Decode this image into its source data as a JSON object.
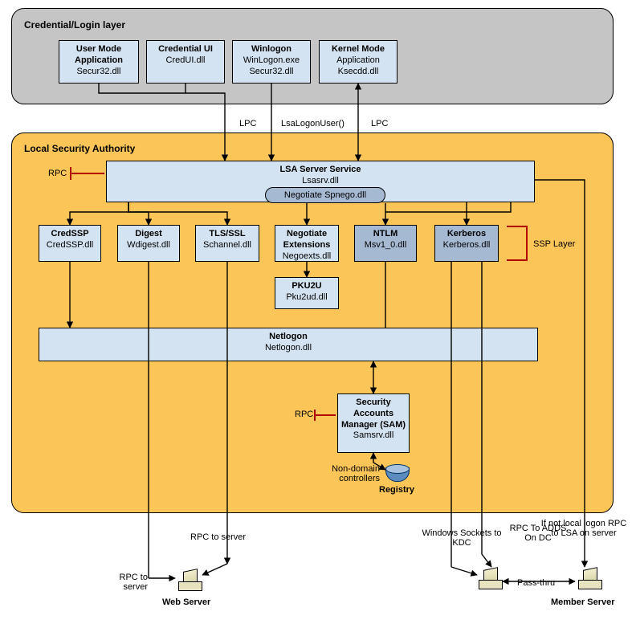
{
  "layers": {
    "credential": {
      "title": "Credential/Login layer"
    },
    "lsa": {
      "title": "Local Security Authority"
    }
  },
  "top_boxes": {
    "user_mode": {
      "title": "User Mode Application",
      "sub": "Secur32.dll"
    },
    "cred_ui": {
      "title": "Credential UI",
      "sub": "CredUI.dll"
    },
    "winlogon": {
      "title": "Winlogon",
      "sub1": "WinLogon.exe",
      "sub2": "Secur32.dll"
    },
    "kernel_mode": {
      "title": "Kernel Mode",
      "sub1": "Application",
      "sub2": "Ksecdd.dll"
    }
  },
  "between": {
    "lpc_left": "LPC",
    "lsa_logon": "LsaLogonUser()",
    "lpc_right": "LPC"
  },
  "lsa_server": {
    "title": "LSA Server Service",
    "sub": "Lsasrv.dll"
  },
  "negotiate_pill": "Negotiate Spnego.dll",
  "ssp": {
    "credssp": {
      "title": "CredSSP",
      "sub": "CredSSP.dll"
    },
    "digest": {
      "title": "Digest",
      "sub": "Wdigest.dll"
    },
    "tls": {
      "title": "TLS/SSL",
      "sub": "Schannel.dll"
    },
    "negoext": {
      "title": "Negotiate Extensions",
      "sub": "Negoexts.dll"
    },
    "ntlm": {
      "title": "NTLM",
      "sub": "Msv1_0.dll"
    },
    "kerberos": {
      "title": "Kerberos",
      "sub": "Kerberos.dll"
    }
  },
  "ssp_layer_label": "SSP Layer",
  "pku2u": {
    "title": "PKU2U",
    "sub": "Pku2ud.dll"
  },
  "netlogon": {
    "title": "Netlogon",
    "sub": "Netlogon.dll"
  },
  "sam": {
    "title": "Security Accounts Manager (SAM)",
    "sub": "Samsrv.dll"
  },
  "rpc_small": "RPC",
  "registry": {
    "nondc": "Non-domain controllers",
    "label": "Registry"
  },
  "bottom": {
    "rpc_to_server_left": "RPC to server",
    "rpc_to_server_very_left": "RPC to server",
    "web_server": "Web Server",
    "sockets_kdc": "Windows Sockets to KDC",
    "rpc_adds": "RPC To ADDS On DC",
    "if_not_local": "If not local logon RPC to LSA  on server",
    "member_server": "Member Server",
    "pass_thru": "Pass-thru"
  }
}
